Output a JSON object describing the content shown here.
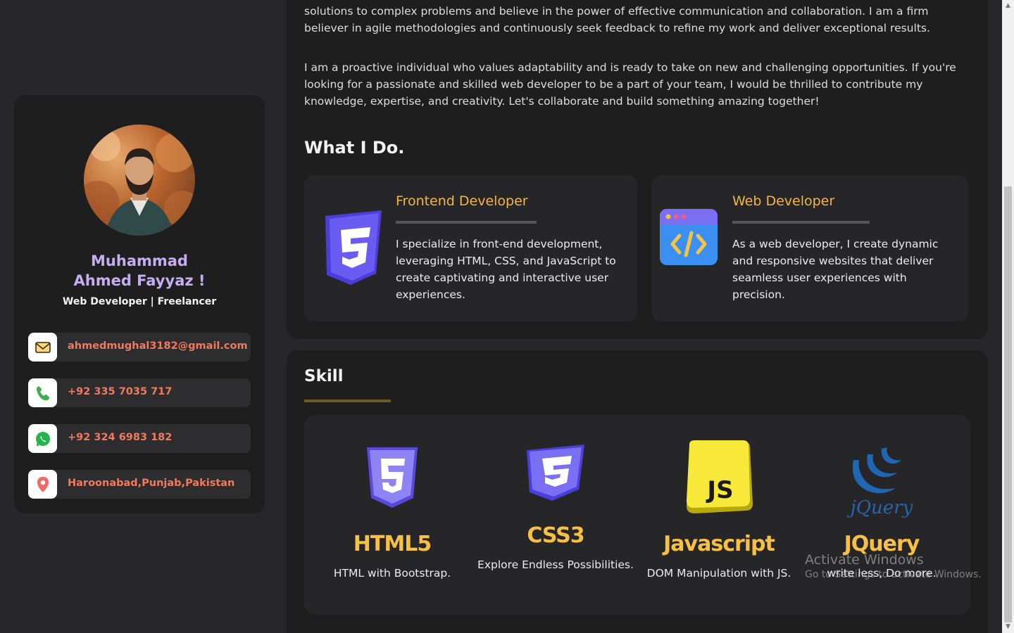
{
  "profile": {
    "name_line1": "Muhammad",
    "name_line2": "Ahmed Fayyaz !",
    "role": "Web Developer | Freelancer"
  },
  "contacts": [
    {
      "icon": "mail-icon",
      "text": "ahmedmughal3182@gmail.com"
    },
    {
      "icon": "phone-icon",
      "text": "+92 335 7035 717"
    },
    {
      "icon": "whatsapp-icon",
      "text": "+92 324 6983 182"
    },
    {
      "icon": "location-pin-icon",
      "text": "Haroonabad,Punjab,Pakistan"
    }
  ],
  "about": {
    "para1": "challenges to expand my skill set. What sets me apart is my relentless drive to learn and grow. I thrive on finding creative solutions to complex problems and believe in the power of effective communication and collaboration. I am a firm believer in agile methodologies and continuously seek feedback to refine my work and deliver exceptional results.",
    "para2": "I am a proactive individual who values adaptability and is ready to take on new and challenging opportunities. If you're looking for a passionate and skilled web developer to be a part of your team, I would be thrilled to contribute my knowledge, expertise, and creativity. Let's collaborate and build something amazing together!"
  },
  "what_i_do": {
    "heading": "What I Do.",
    "services": [
      {
        "icon": "css3-icon",
        "title": "Frontend Developer",
        "desc": "I specialize in front-end development, leveraging HTML, CSS, and JavaScript to create captivating and interactive user experiences."
      },
      {
        "icon": "code-window-icon",
        "title": "Web Developer",
        "desc": "As a web developer, I create dynamic and responsive websites that deliver seamless user experiences with precision."
      }
    ]
  },
  "skills": {
    "heading": "Skill",
    "items": [
      {
        "icon": "html5-icon",
        "name": "HTML5",
        "desc": "HTML with Bootstrap."
      },
      {
        "icon": "css3-icon",
        "name": "CSS3",
        "desc": "Explore Endless Possibilities."
      },
      {
        "icon": "javascript-icon",
        "name": "Javascript",
        "desc": "DOM Manipulation with JS."
      },
      {
        "icon": "jquery-icon",
        "name": "JQuery",
        "desc": "write less, Do more."
      }
    ]
  },
  "watermark": {
    "line1": "Activate Windows",
    "line2": "Go to Settings to activate Windows."
  },
  "colors": {
    "accent_orange": "#f4b540",
    "contact_text": "#f07a5d",
    "name_purple": "#c5aef0",
    "panel_bg": "#1e1e1f",
    "page_bg": "#272729"
  }
}
